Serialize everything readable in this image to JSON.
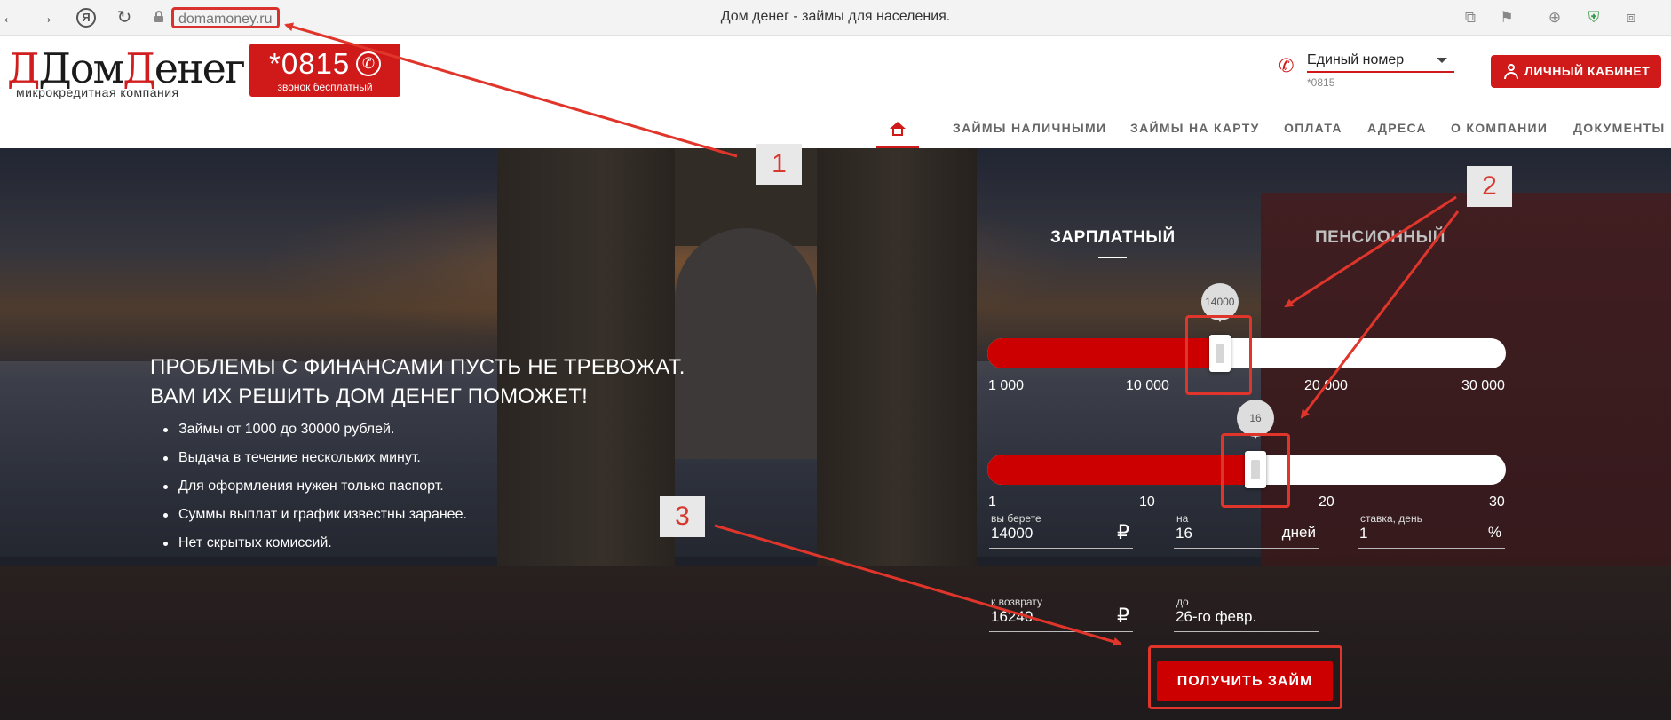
{
  "browser": {
    "url": "domamoney.ru",
    "tab_title": "Дом денег - займы для населения.",
    "ya_label": "Я"
  },
  "header": {
    "logo_text_dark": "Дом",
    "logo_text_red": "Д",
    "logo_text_rest": "енег",
    "logo_subtitle": "микрокредитная компания",
    "phone_number": "*0815",
    "phone_caption": "звонок бесплатный",
    "hotline_label": "Единый номер",
    "hotline_number": "*0815",
    "cabinet_label": "ЛИЧНЫЙ КАБИНЕТ"
  },
  "nav": {
    "items": [
      "ЗАЙМЫ НАЛИЧНЫМИ",
      "ЗАЙМЫ НА КАРТУ",
      "ОПЛАТА",
      "АДРЕСА",
      "О КОМПАНИИ",
      "ДОКУМЕНТЫ"
    ]
  },
  "hero": {
    "title_line1": "ПРОБЛЕМЫ С ФИНАНСАМИ ПУСТЬ НЕ ТРЕВОЖАТ.",
    "title_line2": "ВАМ ИХ РЕШИТЬ ДОМ ДЕНЕГ ПОМОЖЕТ!",
    "features": [
      "Займы от 1000 до 30000 рублей.",
      "Выдача в течение нескольких минут.",
      "Для оформления нужен только паспорт.",
      "Суммы выплат и график известны заранее.",
      "Нет скрытых комиссий."
    ]
  },
  "calculator": {
    "tabs": [
      "ЗАРПЛАТНЫЙ",
      "ПЕНСИОННЫЙ"
    ],
    "amount_slider": {
      "value": 14000,
      "value_label": "14000",
      "min": 1000,
      "max": 30000,
      "ticks": [
        "1 000",
        "10 000",
        "20 000",
        "30 000"
      ]
    },
    "days_slider": {
      "value": 16,
      "value_label": "16",
      "min": 1,
      "max": 30,
      "ticks": [
        "1",
        "10",
        "20",
        "30"
      ]
    },
    "fields": {
      "amount_label": "вы берете",
      "amount_value": "14000",
      "amount_suffix": "₽",
      "days_label": "на",
      "days_value": "16",
      "days_suffix": "дней",
      "rate_label": "ставка, день",
      "rate_value": "1",
      "rate_suffix": "%",
      "return_label": "к возврату",
      "return_value": "16240",
      "return_suffix": "₽",
      "until_label": "до",
      "until_value": "26-го февр."
    },
    "submit_label": "ПОЛУЧИТЬ ЗАЙМ"
  },
  "annotations": {
    "labels": [
      "1",
      "2",
      "3"
    ],
    "color": "#e0352b"
  }
}
